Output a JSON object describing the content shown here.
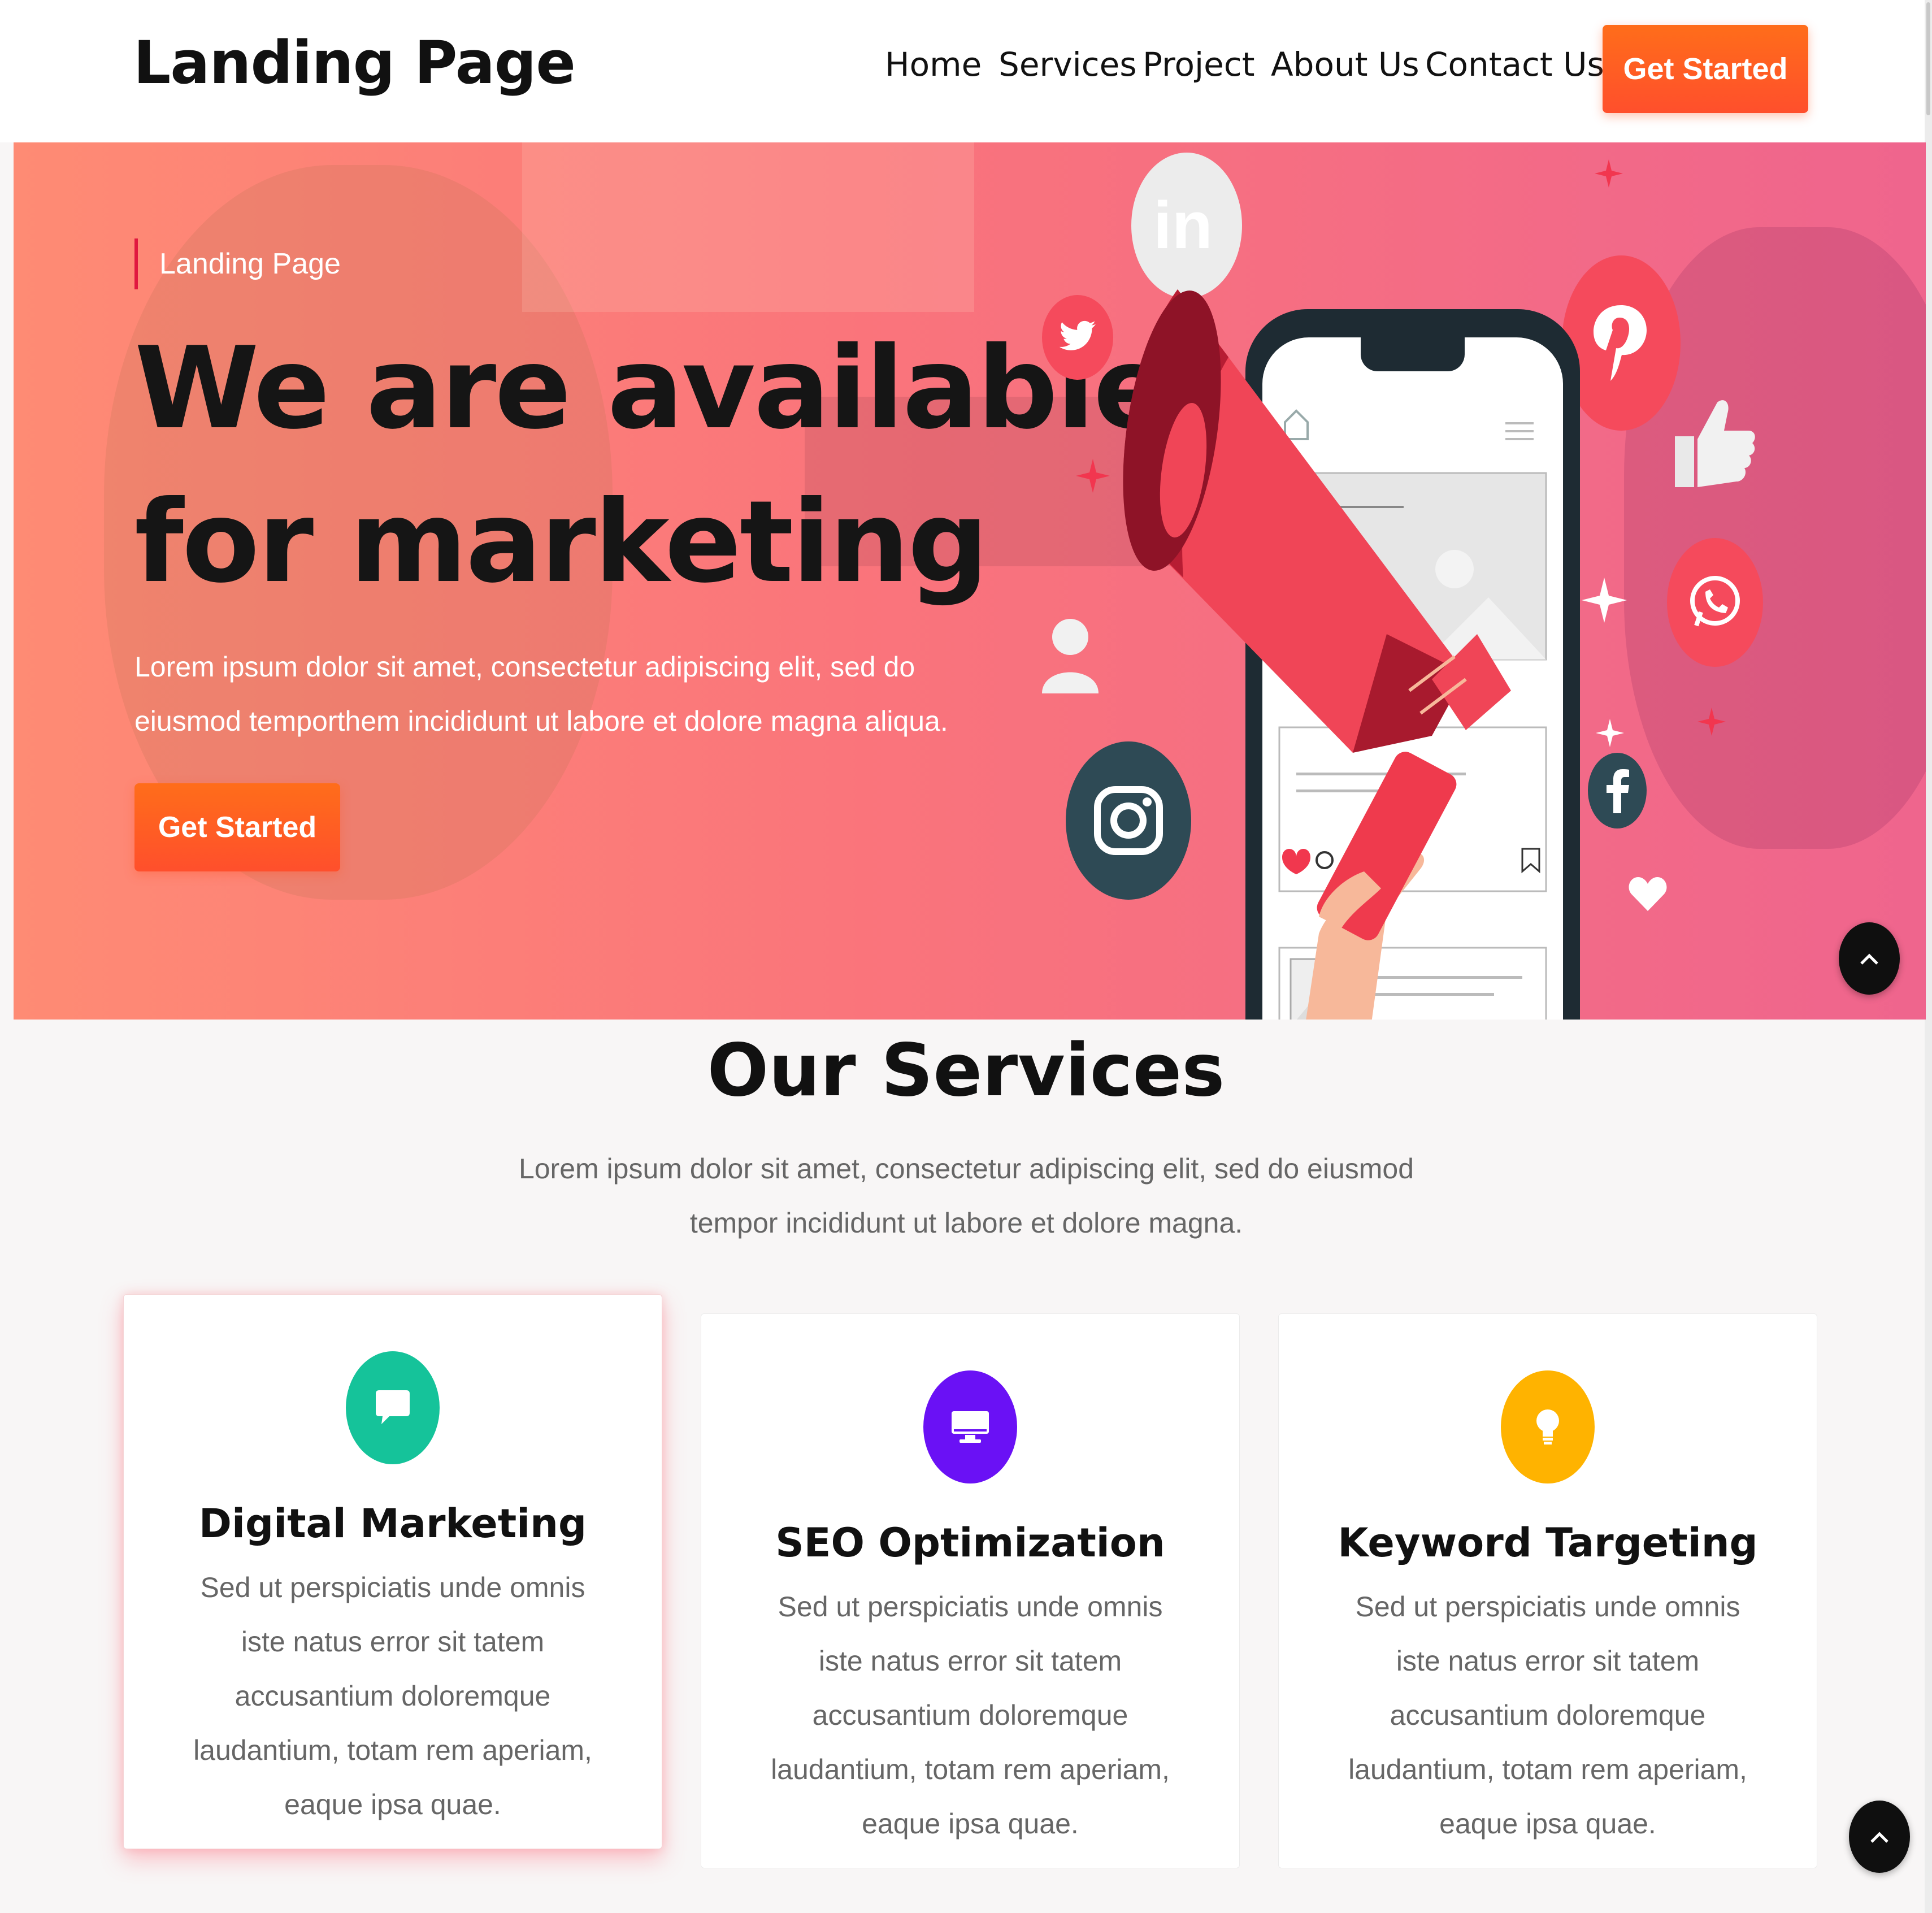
{
  "header": {
    "logo": "Landing Page",
    "nav": [
      "Home",
      "Services",
      "Project",
      "About Us",
      "Contact Us"
    ],
    "cta": "Get Started"
  },
  "hero": {
    "eyebrow": "Landing Page",
    "title_line1": "We are available",
    "title_line2": "for marketing",
    "description": "Lorem ipsum dolor sit amet, consectetur adipiscing elit, sed do eiusmod temporthem incididunt ut labore et dolore magna aliqua.",
    "cta": "Get Started"
  },
  "services": {
    "title": "Our Services",
    "description": "Lorem ipsum dolor sit amet, consectetur adipiscing elit, sed do eiusmod tempor incididunt ut labore et dolore magna.",
    "cards": [
      {
        "title": "Digital Marketing",
        "text": "Sed ut perspiciatis unde omnis iste natus error sit tatem accusantium doloremque laudantium, totam rem aperiam, eaque ipsa quae.",
        "icon": "chat-icon",
        "color": "#15c39a"
      },
      {
        "title": "SEO Optimization",
        "text": "Sed ut perspiciatis unde omnis iste natus error sit tatem accusantium doloremque laudantium, totam rem aperiam, eaque ipsa quae.",
        "icon": "monitor-icon",
        "color": "#6a11f5"
      },
      {
        "title": "Keyword Targeting",
        "text": "Sed ut perspiciatis unde omnis iste natus error sit tatem accusantium doloremque laudantium, totam rem aperiam, eaque ipsa quae.",
        "icon": "lightbulb-icon",
        "color": "#ffb300"
      }
    ]
  },
  "colors": {
    "accent": "#ff5a24",
    "hero_gradient_start": "#ff8469",
    "hero_gradient_end": "#ee5582"
  },
  "illustration_icons": [
    "linkedin-icon",
    "twitter-icon",
    "pinterest-icon",
    "whatsapp-icon",
    "facebook-icon",
    "instagram-icon",
    "user-icon",
    "thumbs-up-icon",
    "heart-icon",
    "megaphone-icon",
    "phone-mockup"
  ]
}
